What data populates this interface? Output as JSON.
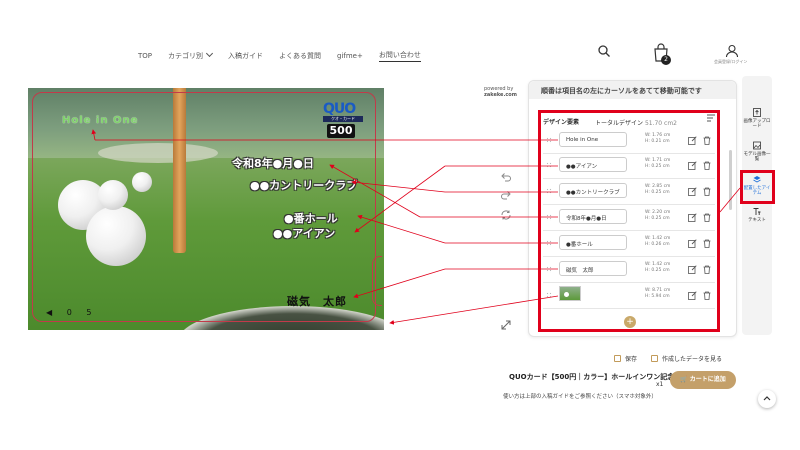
{
  "nav": {
    "items": [
      "TOP",
      "カテゴリ別",
      "入稿ガイド",
      "よくある質問",
      "gifme+",
      "お問い合わせ"
    ],
    "cart_count": "2",
    "user_label": "会員登録/ログイン"
  },
  "canvas": {
    "brand": "QUO",
    "brand_strip": "クオ・カード",
    "amount": "500",
    "text_hole_in_one": "Hole in One",
    "text_date": "令和8年●月●日",
    "text_club": "●●カントリークラブ",
    "text_hole_no": "●番ホール",
    "text_iron": "●●アイアン",
    "text_name": "磁気　太郎",
    "serial": "◀ 0 5"
  },
  "powered": {
    "line1": "powered by",
    "line2": "zakeke.com"
  },
  "panel": {
    "header": "順番は項目名の左にカーソルをあてて移動可能です",
    "list_title": "デザイン要素",
    "total_label": "トータルデザイン",
    "total_value": "51.70 cm2",
    "rows": [
      {
        "name": "Hole in One",
        "w": "W: 1.76 cm",
        "h": "H: 0.21 cm"
      },
      {
        "name": "●●アイアン",
        "w": "W: 1.71 cm",
        "h": "H: 0.25 cm"
      },
      {
        "name": "●●カントリークラブ",
        "w": "W: 2.85 cm",
        "h": "H: 0.25 cm"
      },
      {
        "name": "令和8年●月●日",
        "w": "W: 2.20 cm",
        "h": "H: 0.25 cm"
      },
      {
        "name": "●番ホール",
        "w": "W: 1.42 cm",
        "h": "H: 0.26 cm"
      },
      {
        "name": "磁気　太郎",
        "w": "W: 1.42 cm",
        "h": "H: 0.25 cm"
      },
      {
        "name": "",
        "w": "W: 8.71 cm",
        "h": "H: 5.94 cm"
      }
    ]
  },
  "sidebar": {
    "items": [
      "画像アップロード",
      "モデル画像一覧",
      "配置したアイテム",
      "テキスト"
    ]
  },
  "footer": {
    "save": "保存",
    "view_data": "作成したデータを見る",
    "product": "QUOカード【500円｜カラー】ホールインワン記念",
    "qty": "x1",
    "cart": "カートに追加",
    "hint": "使い方は上部の入稿ガイドをご参照ください（スマホ対象外）"
  },
  "colors": {
    "highlight": "#e0001b",
    "accent": "#c4a06a",
    "link": "#1e6fd9"
  }
}
